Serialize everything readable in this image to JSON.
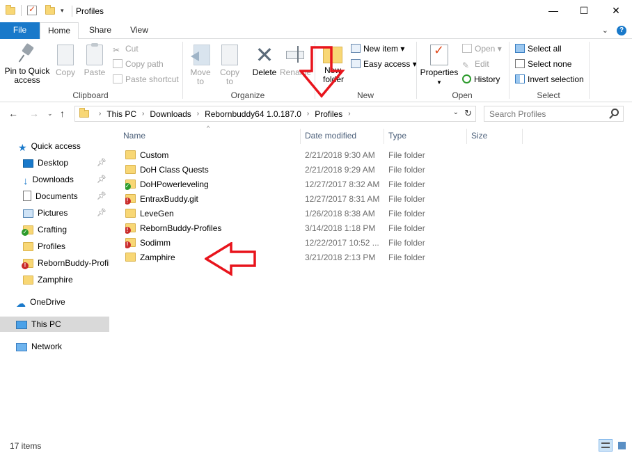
{
  "window": {
    "title": "Profiles",
    "minimize_glyph": "—",
    "maximize_glyph": "☐",
    "close_glyph": "✕"
  },
  "ribbon_tabs": [
    "File",
    "Home",
    "Share",
    "View"
  ],
  "ribbon": {
    "clipboard": {
      "label": "Clipboard",
      "pin_to_quick_access": "Pin to Quick access",
      "copy": "Copy",
      "paste": "Paste",
      "cut": "Cut",
      "copy_path": "Copy path",
      "paste_shortcut": "Paste shortcut"
    },
    "organize": {
      "label": "Organize",
      "move_to": "Move to",
      "copy_to": "Copy to",
      "delete": "Delete",
      "rename": "Rename"
    },
    "new": {
      "label": "New",
      "new_folder": "New folder",
      "new_item": "New item",
      "easy_access": "Easy access"
    },
    "open": {
      "label": "Open",
      "properties": "Properties",
      "open": "Open",
      "edit": "Edit",
      "history": "History"
    },
    "select": {
      "label": "Select",
      "select_all": "Select all",
      "select_none": "Select none",
      "invert_selection": "Invert selection"
    }
  },
  "address": {
    "crumbs": [
      "This PC",
      "Downloads",
      "Rebornbuddy64 1.0.187.0",
      "Profiles"
    ]
  },
  "search": {
    "placeholder": "Search Profiles"
  },
  "nav_pane": {
    "quick_access": "Quick access",
    "pinned": [
      {
        "label": "Desktop",
        "icon": "desktop-icon"
      },
      {
        "label": "Downloads",
        "icon": "downloads-icon"
      },
      {
        "label": "Documents",
        "icon": "documents-icon"
      },
      {
        "label": "Pictures",
        "icon": "pictures-icon"
      }
    ],
    "recent": [
      {
        "label": "Crafting",
        "badge": "ok"
      },
      {
        "label": "Profiles",
        "badge": ""
      },
      {
        "label": "RebornBuddy-Profiles",
        "badge": "err"
      },
      {
        "label": "Zamphire",
        "badge": ""
      }
    ],
    "onedrive": "OneDrive",
    "this_pc": "This PC",
    "network": "Network"
  },
  "columns": {
    "name": "Name",
    "date_modified": "Date modified",
    "type": "Type",
    "size": "Size"
  },
  "files": [
    {
      "name": "Custom",
      "date": "2/21/2018 9:30 AM",
      "type": "File folder",
      "badge": ""
    },
    {
      "name": "DoH Class Quests",
      "date": "2/21/2018 9:29 AM",
      "type": "File folder",
      "badge": ""
    },
    {
      "name": "DoHPowerleveling",
      "date": "12/27/2017 8:32 AM",
      "type": "File folder",
      "badge": "ok"
    },
    {
      "name": "EntraxBuddy.git",
      "date": "12/27/2017 8:31 AM",
      "type": "File folder",
      "badge": "err"
    },
    {
      "name": "LeveGen",
      "date": "1/26/2018 8:38 AM",
      "type": "File folder",
      "badge": ""
    },
    {
      "name": "RebornBuddy-Profiles",
      "date": "3/14/2018 1:18 PM",
      "type": "File folder",
      "badge": "err"
    },
    {
      "name": "Sodimm",
      "date": "12/22/2017 10:52 ...",
      "type": "File folder",
      "badge": "err"
    },
    {
      "name": "Zamphire",
      "date": "3/21/2018 2:13 PM",
      "type": "File folder",
      "badge": ""
    }
  ],
  "status": {
    "item_count": "17 items"
  },
  "colors": {
    "accent": "#1979ca",
    "annotation": "#e8141c"
  }
}
